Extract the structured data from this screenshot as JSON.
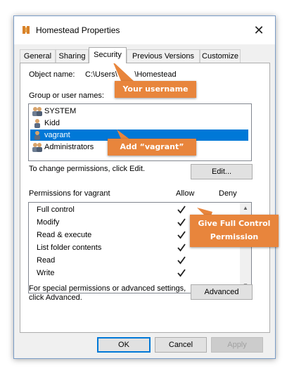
{
  "window": {
    "title": "Homestead Properties",
    "close_glyph": "✕"
  },
  "tabs": [
    "General",
    "Sharing",
    "Security",
    "Previous Versions",
    "Customize"
  ],
  "object_name": {
    "label": "Object name:",
    "value": "C:\\Users\\        \\Homestead"
  },
  "group_label": "Group or user names:",
  "users": [
    {
      "name": "SYSTEM",
      "icon": "user-group-icon"
    },
    {
      "name": "Kidd",
      "icon": "user-icon"
    },
    {
      "name": "vagrant",
      "icon": "user-icon",
      "selected": true
    },
    {
      "name": "Administrators",
      "icon": "user-group-icon"
    }
  ],
  "change_perm_text": "To change permissions, click Edit.",
  "edit_button": "Edit...",
  "permissions": {
    "label": "Permissions for vagrant",
    "allow_header": "Allow",
    "deny_header": "Deny",
    "rows": [
      {
        "name": "Full control",
        "allow": true,
        "deny": false
      },
      {
        "name": "Modify",
        "allow": true,
        "deny": false
      },
      {
        "name": "Read & execute",
        "allow": true,
        "deny": false
      },
      {
        "name": "List folder contents",
        "allow": true,
        "deny": false
      },
      {
        "name": "Read",
        "allow": true,
        "deny": false
      },
      {
        "name": "Write",
        "allow": true,
        "deny": false
      }
    ]
  },
  "special_text_1": "For special permissions or advanced settings,",
  "special_text_2": "click Advanced.",
  "advanced_button": "Advanced",
  "footer": {
    "ok": "OK",
    "cancel": "Cancel",
    "apply": "Apply"
  },
  "callouts": {
    "username": "Your username",
    "add_vagrant": "Add “vagrant”",
    "full_control_1": "Give Full Control",
    "full_control_2": "Permission"
  },
  "colors": {
    "callout": "#e8853c",
    "selection": "#0078d7"
  }
}
